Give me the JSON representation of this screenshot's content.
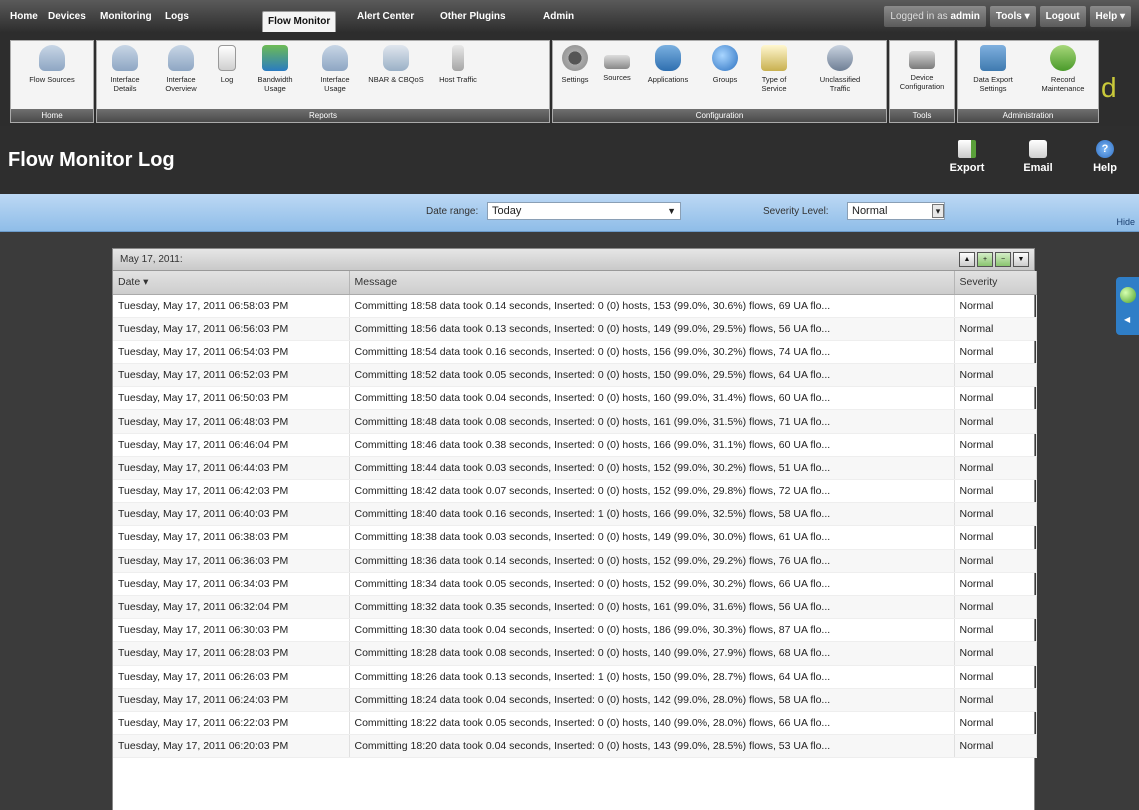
{
  "nav": {
    "items": [
      "Home",
      "Devices",
      "Monitoring",
      "Logs",
      "Flow Monitor",
      "Alert Center",
      "Other Plugins",
      "Admin"
    ],
    "active": "Flow Monitor",
    "logged_in_prefix": "Logged in as",
    "user": "admin",
    "tools": "Tools ▾",
    "logout": "Logout",
    "help": "Help ▾"
  },
  "ribbon": {
    "groups": {
      "home": "Home",
      "reports": "Reports",
      "configuration": "Configuration",
      "tools": "Tools",
      "administration": "Administration"
    },
    "buttons": {
      "flow_sources": "Flow Sources",
      "interface_details": "Interface Details",
      "interface_overview": "Interface Overview",
      "log": "Log",
      "bandwidth_usage": "Bandwidth Usage",
      "interface_usage": "Interface Usage",
      "nbar_cbqos": "NBAR & CBQoS",
      "host_traffic": "Host Traffic",
      "settings": "Settings",
      "sources": "Sources",
      "applications": "Applications",
      "groups": "Groups",
      "type_of_service": "Type of Service",
      "unclassified_traffic": "Unclassified Traffic",
      "device_configuration": "Device Configuration",
      "data_export_settings": "Data Export Settings",
      "record_maintenance": "Record Maintenance"
    }
  },
  "page": {
    "title": "Flow Monitor Log",
    "export": "Export",
    "email": "Email",
    "help": "Help"
  },
  "filters": {
    "date_range_label": "Date range:",
    "date_range_value": "Today",
    "severity_label": "Severity Level:",
    "severity_value": "Normal",
    "hide": "Hide"
  },
  "panel": {
    "date": "May 17, 2011:",
    "columns": [
      "Date ▾",
      "Message",
      "Severity"
    ]
  },
  "rows": [
    {
      "date": "Tuesday, May 17, 2011 06:58:03 PM",
      "message": "Committing 18:58 data took 0.14 seconds, Inserted: 0 (0) hosts, 153 (99.0%, 30.6%) flows, 69 UA flo...",
      "severity": "Normal"
    },
    {
      "date": "Tuesday, May 17, 2011 06:56:03 PM",
      "message": "Committing 18:56 data took 0.13 seconds, Inserted: 0 (0) hosts, 149 (99.0%, 29.5%) flows, 56 UA flo...",
      "severity": "Normal"
    },
    {
      "date": "Tuesday, May 17, 2011 06:54:03 PM",
      "message": "Committing 18:54 data took 0.16 seconds, Inserted: 0 (0) hosts, 156 (99.0%, 30.2%) flows, 74 UA flo...",
      "severity": "Normal"
    },
    {
      "date": "Tuesday, May 17, 2011 06:52:03 PM",
      "message": "Committing 18:52 data took 0.05 seconds, Inserted: 0 (0) hosts, 150 (99.0%, 29.5%) flows, 64 UA flo...",
      "severity": "Normal"
    },
    {
      "date": "Tuesday, May 17, 2011 06:50:03 PM",
      "message": "Committing 18:50 data took 0.04 seconds, Inserted: 0 (0) hosts, 160 (99.0%, 31.4%) flows, 60 UA flo...",
      "severity": "Normal"
    },
    {
      "date": "Tuesday, May 17, 2011 06:48:03 PM",
      "message": "Committing 18:48 data took 0.08 seconds, Inserted: 0 (0) hosts, 161 (99.0%, 31.5%) flows, 71 UA flo...",
      "severity": "Normal"
    },
    {
      "date": "Tuesday, May 17, 2011 06:46:04 PM",
      "message": "Committing 18:46 data took 0.38 seconds, Inserted: 0 (0) hosts, 166 (99.0%, 31.1%) flows, 60 UA flo...",
      "severity": "Normal"
    },
    {
      "date": "Tuesday, May 17, 2011 06:44:03 PM",
      "message": "Committing 18:44 data took 0.03 seconds, Inserted: 0 (0) hosts, 152 (99.0%, 30.2%) flows, 51 UA flo...",
      "severity": "Normal"
    },
    {
      "date": "Tuesday, May 17, 2011 06:42:03 PM",
      "message": "Committing 18:42 data took 0.07 seconds, Inserted: 0 (0) hosts, 152 (99.0%, 29.8%) flows, 72 UA flo...",
      "severity": "Normal"
    },
    {
      "date": "Tuesday, May 17, 2011 06:40:03 PM",
      "message": "Committing 18:40 data took 0.16 seconds, Inserted: 1 (0) hosts, 166 (99.0%, 32.5%) flows, 58 UA flo...",
      "severity": "Normal"
    },
    {
      "date": "Tuesday, May 17, 2011 06:38:03 PM",
      "message": "Committing 18:38 data took 0.03 seconds, Inserted: 0 (0) hosts, 149 (99.0%, 30.0%) flows, 61 UA flo...",
      "severity": "Normal"
    },
    {
      "date": "Tuesday, May 17, 2011 06:36:03 PM",
      "message": "Committing 18:36 data took 0.14 seconds, Inserted: 0 (0) hosts, 152 (99.0%, 29.2%) flows, 76 UA flo...",
      "severity": "Normal"
    },
    {
      "date": "Tuesday, May 17, 2011 06:34:03 PM",
      "message": "Committing 18:34 data took 0.05 seconds, Inserted: 0 (0) hosts, 152 (99.0%, 30.2%) flows, 66 UA flo...",
      "severity": "Normal"
    },
    {
      "date": "Tuesday, May 17, 2011 06:32:04 PM",
      "message": "Committing 18:32 data took 0.35 seconds, Inserted: 0 (0) hosts, 161 (99.0%, 31.6%) flows, 56 UA flo...",
      "severity": "Normal"
    },
    {
      "date": "Tuesday, May 17, 2011 06:30:03 PM",
      "message": "Committing 18:30 data took 0.04 seconds, Inserted: 0 (0) hosts, 186 (99.0%, 30.3%) flows, 87 UA flo...",
      "severity": "Normal"
    },
    {
      "date": "Tuesday, May 17, 2011 06:28:03 PM",
      "message": "Committing 18:28 data took 0.08 seconds, Inserted: 0 (0) hosts, 140 (99.0%, 27.9%) flows, 68 UA flo...",
      "severity": "Normal"
    },
    {
      "date": "Tuesday, May 17, 2011 06:26:03 PM",
      "message": "Committing 18:26 data took 0.13 seconds, Inserted: 1 (0) hosts, 150 (99.0%, 28.7%) flows, 64 UA flo...",
      "severity": "Normal"
    },
    {
      "date": "Tuesday, May 17, 2011 06:24:03 PM",
      "message": "Committing 18:24 data took 0.04 seconds, Inserted: 0 (0) hosts, 142 (99.0%, 28.0%) flows, 58 UA flo...",
      "severity": "Normal"
    },
    {
      "date": "Tuesday, May 17, 2011 06:22:03 PM",
      "message": "Committing 18:22 data took 0.05 seconds, Inserted: 0 (0) hosts, 140 (99.0%, 28.0%) flows, 66 UA flo...",
      "severity": "Normal"
    },
    {
      "date": "Tuesday, May 17, 2011 06:20:03 PM",
      "message": "Committing 18:20 data took 0.04 seconds, Inserted: 0 (0) hosts, 143 (99.0%, 28.5%) flows, 53 UA flo...",
      "severity": "Normal"
    }
  ]
}
